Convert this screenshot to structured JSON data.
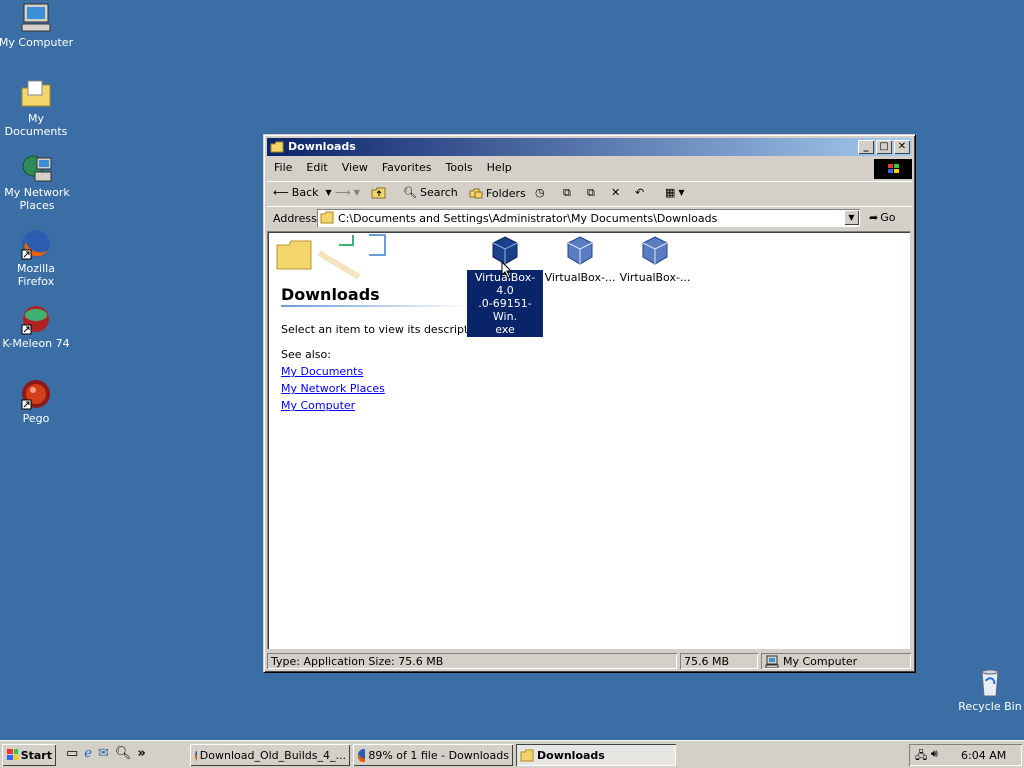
{
  "desktop": {
    "icons": [
      {
        "label": "My Computer"
      },
      {
        "label": "My Documents"
      },
      {
        "label": "My Network Places"
      },
      {
        "label": "Mozilla Firefox"
      },
      {
        "label": "K-Meleon 74"
      },
      {
        "label": "Pego"
      }
    ],
    "recycle_bin": "Recycle Bin"
  },
  "window": {
    "title": "Downloads",
    "menu": [
      "File",
      "Edit",
      "View",
      "Favorites",
      "Tools",
      "Help"
    ],
    "toolbar": {
      "back": "Back",
      "search": "Search",
      "folders": "Folders"
    },
    "address": {
      "label": "Address",
      "value": "C:\\Documents and Settings\\Administrator\\My Documents\\Downloads",
      "go": "Go"
    },
    "panel": {
      "heading": "Downloads",
      "description": "Select an item to view its description.",
      "see_also": "See also:",
      "links": [
        "My Documents",
        "My Network Places",
        "My Computer"
      ]
    },
    "files": [
      {
        "label": "VirtualBox-4.0.0-69151-Win.exe",
        "label_line1": "VirtualBox-4.0",
        "label_line2": ".0-69151-Win.",
        "label_line3": "exe",
        "selected": true
      },
      {
        "label": "VirtualBox-..."
      },
      {
        "label": "VirtualBox-..."
      }
    ],
    "status": {
      "type_size": "Type: Application Size: 75.6 MB",
      "size": "75.6 MB",
      "zone": "My Computer"
    }
  },
  "taskbar": {
    "start": "Start",
    "tasks": [
      {
        "label": "Download_Old_Builds_4_..."
      },
      {
        "label": "89% of 1 file - Downloads"
      },
      {
        "label": "Downloads",
        "active": true
      }
    ],
    "clock": "6:04 AM"
  },
  "colors": {
    "desktop": "#3a6ea5",
    "title_active": "#0a246a",
    "selection": "#0a246a"
  }
}
